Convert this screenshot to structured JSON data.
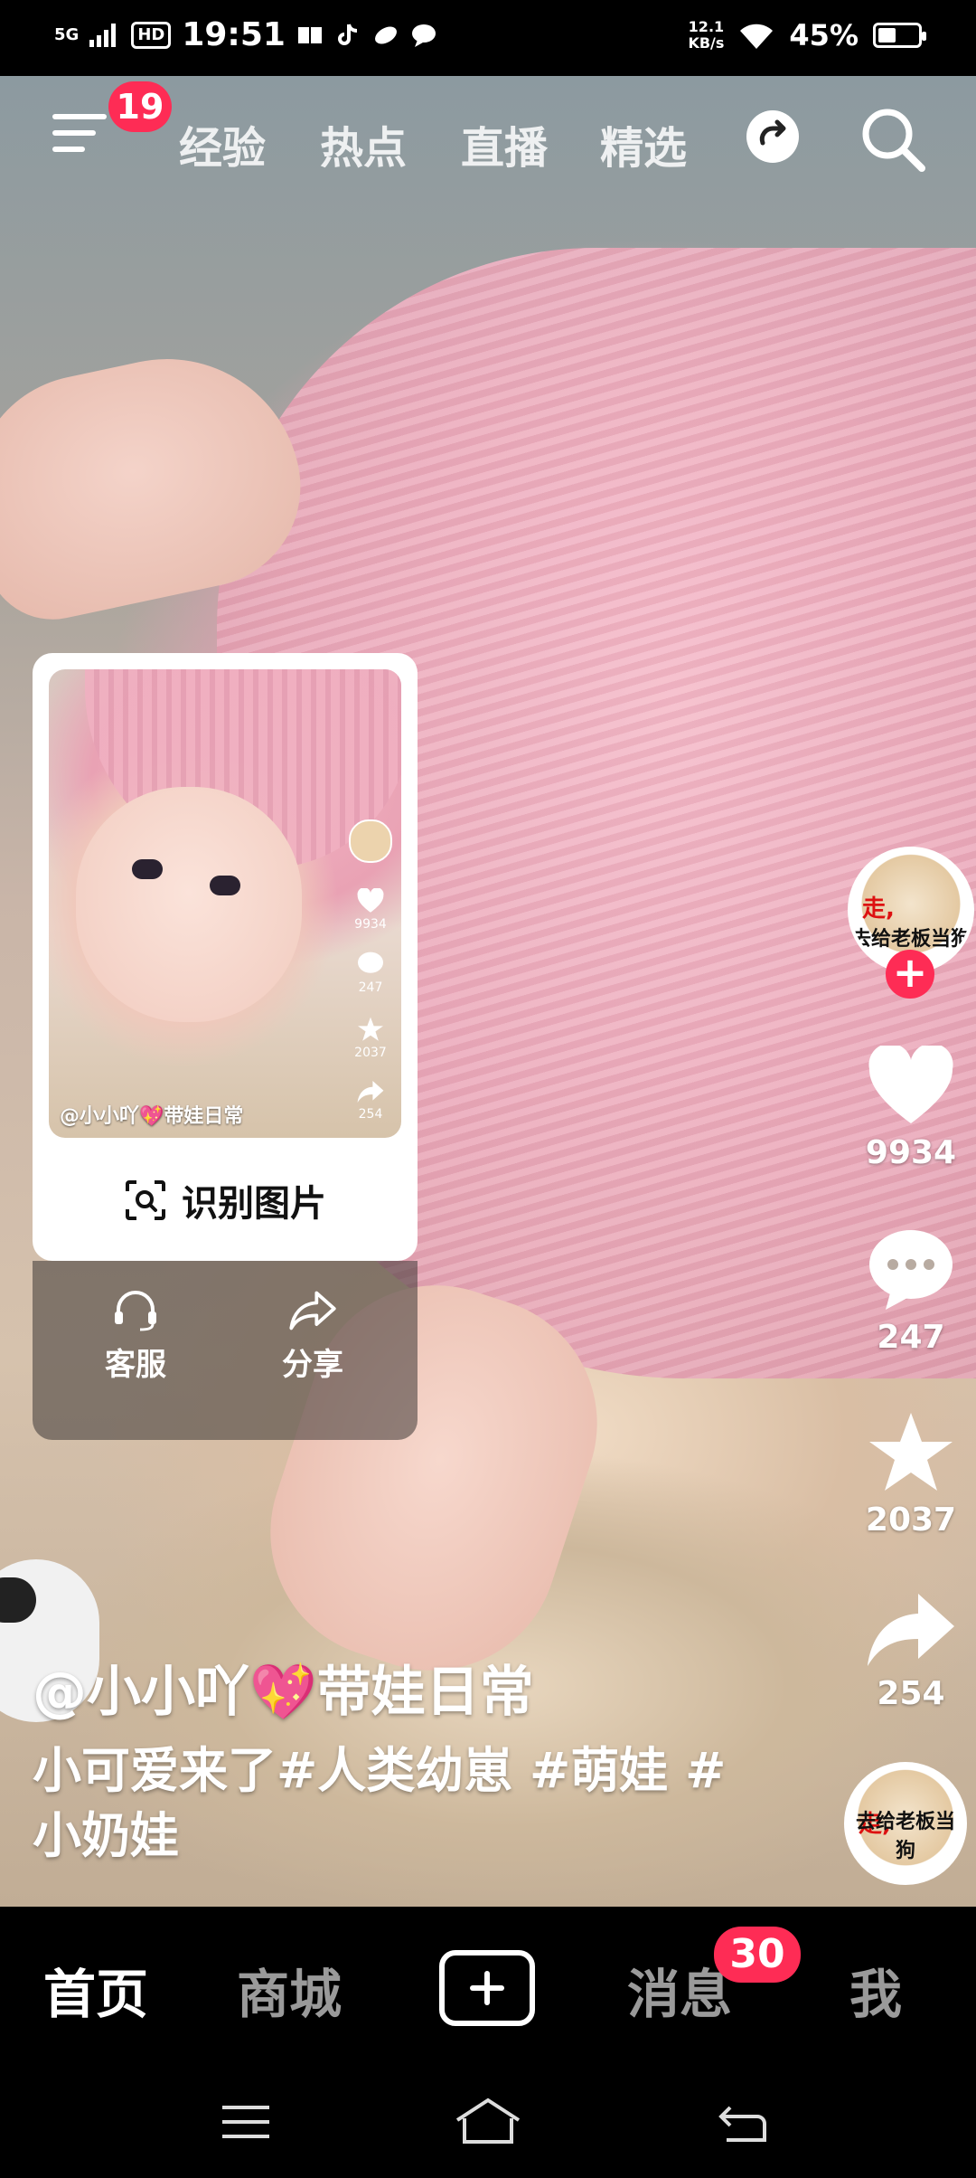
{
  "status_bar": {
    "time": "19:51",
    "network": "5G",
    "hd": "HD",
    "net_speed_value": "12.1",
    "net_speed_unit": "KB/s",
    "battery": "45%",
    "battery_level": 0.45
  },
  "top_tabs": {
    "menu_badge": "19",
    "tabs": [
      "经验",
      "热点",
      "直播",
      "精选"
    ]
  },
  "actions": {
    "likes": "9934",
    "comments": "247",
    "favorites": "2037",
    "shares": "254",
    "avatar_caption": "去给老板当狗",
    "avatar_corner": "走,",
    "follow_label": "+"
  },
  "video": {
    "author": "@小小吖💖带娃日常",
    "caption": "小可爱来了#人类幼崽 #萌娃 #小奶娃"
  },
  "popup": {
    "thumb_name": "@小小吖💖带娃日常",
    "thumb_likes": "9934",
    "thumb_comments": "247",
    "thumb_favorites": "2037",
    "thumb_shares": "254",
    "recognize_label": "识别图片",
    "service_label": "客服",
    "share_label": "分享"
  },
  "bottom_nav": {
    "home": "首页",
    "mall": "商城",
    "messages": "消息",
    "messages_badge": "30",
    "me": "我"
  },
  "colors": {
    "accent": "#fe2c55",
    "nav_inactive": "#9a9a9a"
  }
}
